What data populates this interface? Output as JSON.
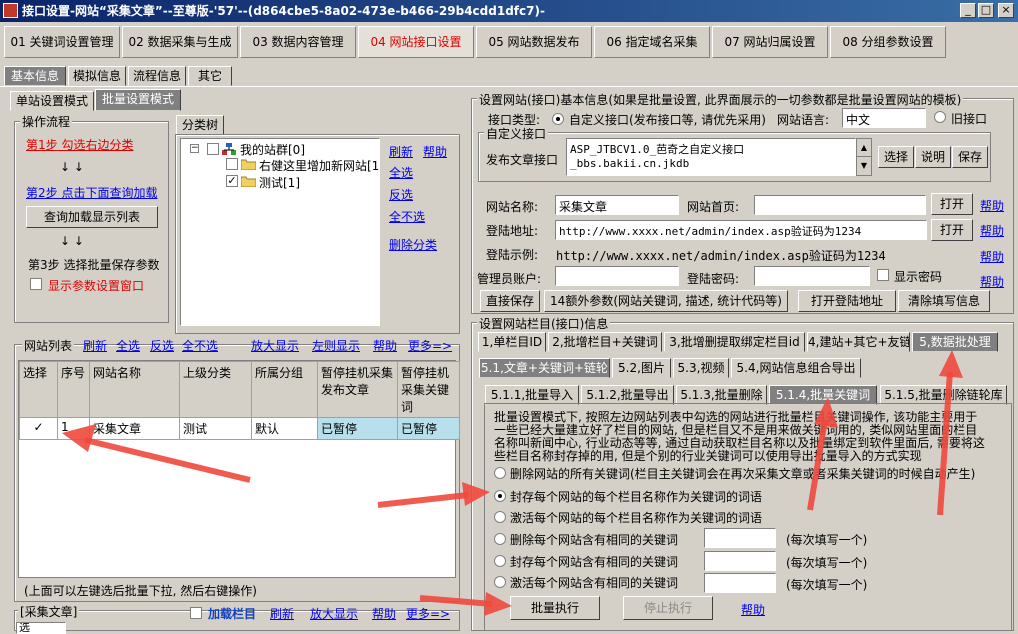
{
  "window": {
    "title": "接口设置-网站“采集文章”--至尊版-'57'--(d864cbe5-8a02-473e-b466-29b4cdd1dfc7)-"
  },
  "main_tabs": [
    "01 关键词设置管理",
    "02 数据采集与生成",
    "03 数据内容管理",
    "04 网站接口设置",
    "05 网站数据发布",
    "06 指定域名采集",
    "07 网站归属设置",
    "08 分组参数设置"
  ],
  "sub_tabs": [
    "基本信息",
    "模拟信息",
    "流程信息",
    "其它"
  ],
  "mode_tabs": [
    "单站设置模式",
    "批量设置模式"
  ],
  "workflow": {
    "title": "操作流程",
    "step1": "第1步  勾选右边分类",
    "arrows": "↓    ↓",
    "step2": "第2步  点击下面查询加载",
    "query_button": "查询加载显示列表",
    "step3": "第3步  选择批量保存参数",
    "show_param_window": "显示参数设置窗口"
  },
  "category_tree": {
    "tab": "分类树",
    "root": "我的站群[0]",
    "children": [
      "右健这里增加新网站[1",
      "测试[1]"
    ],
    "links": [
      "刷新",
      "帮助",
      "全选",
      "反选",
      "全不选",
      "删除分类"
    ]
  },
  "site_list": {
    "title": "网站列表",
    "links": [
      "刷新",
      "全选",
      "反选",
      "全不选",
      "放大显示",
      "左则显示",
      "帮助",
      "更多=>"
    ],
    "columns": [
      "选择",
      "序号",
      "网站名称",
      "上级分类",
      "所属分组",
      "暂停挂机采集发布文章",
      "暂停挂机采集关键词"
    ],
    "rows": [
      [
        "✓",
        "1",
        "采集文章",
        "测试",
        "默认",
        "已暂停",
        "已暂停"
      ]
    ],
    "hint": "(上面可以左键选后批量下拉, 然后右键操作)"
  },
  "bottom_bar": {
    "title": "[采集文章]",
    "load_column": "加载栏目",
    "links": [
      "刷新",
      "放大显示",
      "帮助",
      "更多=>"
    ],
    "cell": "选"
  },
  "site_info": {
    "title": "设置网站(接口)基本信息(如果是批量设置, 此界面展示的一切参数都是批量设置网站的模板)",
    "interface_type_label": "接口类型:",
    "custom_interface": "自定义接口(发布接口等, 请优先采用)",
    "language_label": "网站语言:",
    "language": "中文",
    "old_interface": "旧接口",
    "custom_group": "自定义接口",
    "publish_label": "发布文章接口",
    "publish_value": "ASP_JTBCV1.0_芭奇之自定义接口_bbs.bakii.cn.jkdb",
    "choose": "选择",
    "explain": "说明",
    "save": "保存",
    "site_name_label": "网站名称:",
    "site_name": "采集文章",
    "homepage_label": "网站首页:",
    "homepage": "",
    "open": "打开",
    "help": "帮助",
    "login_label": "登陆地址:",
    "login_url": "http://www.xxxx.net/admin/index.asp验证码为1234",
    "example_label": "登陆示例:",
    "example": "http://www.xxxx.net/admin/index.asp验证码为1234",
    "admin_label": "管理员账户:",
    "password_label": "登陆密码:",
    "show_password": "显示密码",
    "direct_save": "直接保存",
    "extra_params": "14额外参数(网站关键词, 描述, 统计代码等)",
    "open_login": "打开登陆地址",
    "clear_info": "清除填写信息"
  },
  "column_info": {
    "title": "设置网站栏目(接口)信息",
    "tabs": [
      "1,单栏目ID",
      "2,批增栏目+关键词",
      "3,批增删提取绑定栏目id",
      "4,建站+其它+友链",
      "5,数据批处理"
    ],
    "subtabs": [
      "5.1,文章+关键词+链轮",
      "5.2,图片",
      "5.3,视频",
      "5.4,网站信息组合导出"
    ],
    "subsubtabs": [
      "5.1.1,批量导入",
      "5.1.2,批量导出",
      "5.1.3,批量删除",
      "5.1.4,批量关键词",
      "5.1.5,批量删除链轮库"
    ],
    "description": "批量设置模式下, 按照左边网站列表中勾选的网站进行批量栏目关键词操作, 该功能主要用于一些已经大量建立好了栏目的网站, 但是栏目又不是用来做关键词用的, 类似网站里面的栏目名称叫新闻中心, 行业动态等等, 通过自动获取栏目名称以及批量绑定到软件里面后, 需要将这些栏目名称封存掉的用, 但是个别的行业关键词可以使用导出批量导入的方式实现",
    "options": [
      "删除网站的所有关键词(栏目主关键词会在再次采集文章或者采集关键词的时候自动产生)",
      "封存每个网站的每个栏目名称作为关键词的词语",
      "激活每个网站的每个栏目名称作为关键词的词语",
      "删除每个网站含有相同的关键词",
      "封存每个网站含有相同的关键词",
      "激活每个网站含有相同的关键词"
    ],
    "per_line": "(每次填写一个)",
    "execute": "批量执行",
    "stop": "停止执行",
    "help": "帮助"
  },
  "colors": {
    "title_start": "#0a246a",
    "title_end": "#3a6ea5",
    "active_tab_text": "#e00000",
    "annotation": "#f0483c",
    "row_select": "#b8e0ec"
  }
}
